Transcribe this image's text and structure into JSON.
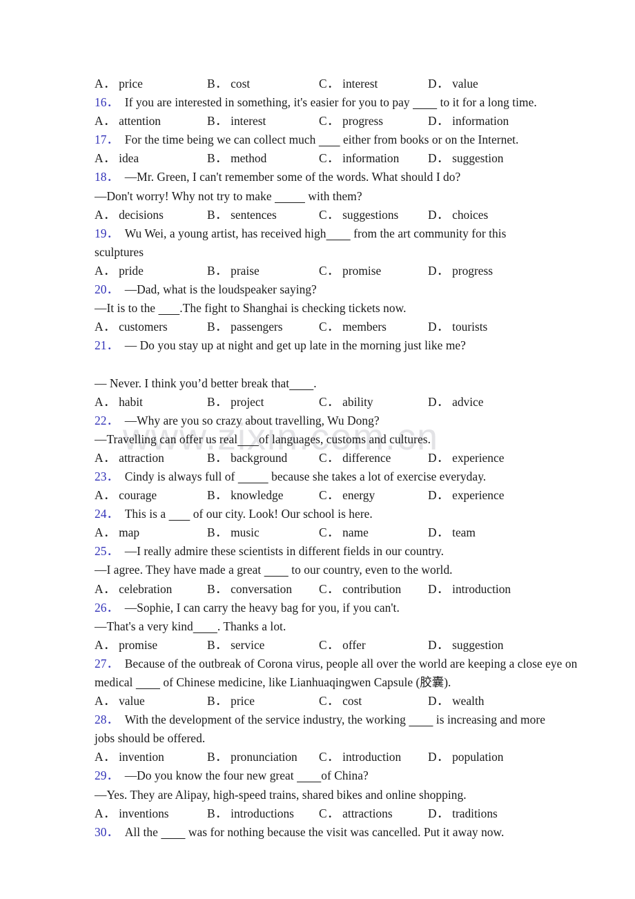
{
  "watermark": {
    "text": "www.zixin.com.cn"
  },
  "colors": {
    "question_number": "#3333b8",
    "body_text": "#1a1a1a",
    "watermark": "#e3e3e6"
  },
  "blank": "________",
  "blank_long": "__________",
  "blank_short": "_______",
  "blocks": [
    {
      "kind": "options",
      "options": [
        {
          "label": "A．",
          "text": "price"
        },
        {
          "label": "B．",
          "text": "cost"
        },
        {
          "label": "C．",
          "text": "interest"
        },
        {
          "label": "D．",
          "text": "value"
        }
      ]
    },
    {
      "kind": "question",
      "number": "16．",
      "lines": [
        {
          "pre": "If you are interested in something, it's easier for you to pay ",
          "blank": "________",
          "post": " to it for a long time."
        }
      ],
      "options": [
        {
          "label": "A．",
          "text": "attention"
        },
        {
          "label": "B．",
          "text": "interest"
        },
        {
          "label": "C．",
          "text": "progress"
        },
        {
          "label": "D．",
          "text": "information"
        }
      ]
    },
    {
      "kind": "question",
      "number": "17．",
      "lines": [
        {
          "pre": "For the time being we can collect much ",
          "blank": "_______",
          "post": " either from books or on the Internet."
        }
      ],
      "options": [
        {
          "label": "A．",
          "text": "idea"
        },
        {
          "label": "B．",
          "text": "method"
        },
        {
          "label": "C．",
          "text": "information"
        },
        {
          "label": "D．",
          "text": "suggestion"
        }
      ]
    },
    {
      "kind": "question",
      "number": "18．",
      "lines": [
        {
          "pre": "—Mr. Green, I can't remember some of the words. What should I do?",
          "blank": "",
          "post": ""
        },
        {
          "pre": "—Don't worry! Why not try to make ",
          "blank": "__________",
          "post": " with them?",
          "noindent": true
        }
      ],
      "options": [
        {
          "label": "A．",
          "text": "decisions"
        },
        {
          "label": "B．",
          "text": "sentences"
        },
        {
          "label": "C．",
          "text": "suggestions"
        },
        {
          "label": "D．",
          "text": "choices"
        }
      ]
    },
    {
      "kind": "question",
      "number": "19．",
      "lines": [
        {
          "pre": "Wu Wei, a young artist, has received high",
          "blank": "________",
          "post": " from the art community for this"
        },
        {
          "pre": "sculptures",
          "blank": "",
          "post": "",
          "noindent": true
        }
      ],
      "options": [
        {
          "label": "A．",
          "text": "pride"
        },
        {
          "label": "B．",
          "text": "praise"
        },
        {
          "label": "C．",
          "text": "promise"
        },
        {
          "label": "D．",
          "text": "progress"
        }
      ]
    },
    {
      "kind": "question",
      "number": "20．",
      "lines": [
        {
          "pre": "—Dad, what is the loudspeaker saying?",
          "blank": "",
          "post": ""
        },
        {
          "pre": "—It is to the ",
          "blank": "_______",
          "post": ".The fight to Shanghai is checking tickets now.",
          "noindent": true
        }
      ],
      "options": [
        {
          "label": "A．",
          "text": "customers"
        },
        {
          "label": "B．",
          "text": "passengers"
        },
        {
          "label": "C．",
          "text": "members"
        },
        {
          "label": "D．",
          "text": "tourists"
        }
      ]
    },
    {
      "kind": "question",
      "number": "21．",
      "lines": [
        {
          "pre": "— Do you stay up at night and get up late in the morning just like me?",
          "blank": "",
          "post": ""
        },
        {
          "pre": "",
          "blank": "",
          "post": "",
          "isblanksep": true
        },
        {
          "pre": "— Never. I think you’d better break that",
          "blank": "________",
          "post": ".",
          "noindent": true
        }
      ],
      "options": [
        {
          "label": "A．",
          "text": "habit"
        },
        {
          "label": "B．",
          "text": "project"
        },
        {
          "label": "C．",
          "text": "ability"
        },
        {
          "label": "D．",
          "text": "advice"
        }
      ]
    },
    {
      "kind": "question",
      "number": "22．",
      "lines": [
        {
          "pre": "—Why are you so crazy about travelling, Wu Dong?",
          "blank": "",
          "post": ""
        },
        {
          "pre": "—Travelling can offer us real",
          "blank": "_______",
          "post": "of languages, customs and cultures.",
          "noindent": true
        }
      ],
      "options": [
        {
          "label": "A．",
          "text": "attraction"
        },
        {
          "label": "B．",
          "text": "background"
        },
        {
          "label": "C．",
          "text": "difference"
        },
        {
          "label": "D．",
          "text": "experience"
        }
      ]
    },
    {
      "kind": "question",
      "number": "23．",
      "lines": [
        {
          "pre": "Cindy is always full of ",
          "blank": "__________",
          "post": " because she takes a lot of exercise everyday."
        }
      ],
      "options": [
        {
          "label": "A．",
          "text": "courage"
        },
        {
          "label": "B．",
          "text": "knowledge"
        },
        {
          "label": "C．",
          "text": "energy"
        },
        {
          "label": "D．",
          "text": "experience"
        }
      ]
    },
    {
      "kind": "question",
      "number": "24．",
      "lines": [
        {
          "pre": "This is a ",
          "blank": "_______",
          "post": " of our city. Look! Our school is here."
        }
      ],
      "options": [
        {
          "label": "A．",
          "text": "map"
        },
        {
          "label": "B．",
          "text": "music"
        },
        {
          "label": "C．",
          "text": "name"
        },
        {
          "label": "D．",
          "text": "team"
        }
      ]
    },
    {
      "kind": "question",
      "number": "25．",
      "lines": [
        {
          "pre": "—I really admire these scientists in different fields in our country.",
          "blank": "",
          "post": ""
        },
        {
          "pre": "—I agree. They have made a great ",
          "blank": "________",
          "post": " to our country, even to the world.",
          "noindent": true
        }
      ],
      "options": [
        {
          "label": "A．",
          "text": "celebration"
        },
        {
          "label": "B．",
          "text": "conversation"
        },
        {
          "label": "C．",
          "text": "contribution"
        },
        {
          "label": "D．",
          "text": "introduction"
        }
      ]
    },
    {
      "kind": "question",
      "number": "26．",
      "lines": [
        {
          "pre": "—Sophie, I can carry the heavy bag for you, if you can't.",
          "blank": "",
          "post": ""
        },
        {
          "pre": "—That's a very kind",
          "blank": "________",
          "post": ". Thanks a lot.",
          "noindent": true
        }
      ],
      "options": [
        {
          "label": "A．",
          "text": "promise"
        },
        {
          "label": "B．",
          "text": "service"
        },
        {
          "label": "C．",
          "text": "offer"
        },
        {
          "label": "D．",
          "text": "suggestion"
        }
      ]
    },
    {
      "kind": "question",
      "number": "27．",
      "lines": [
        {
          "pre": "Because of the outbreak of Corona virus, people all over the world are keeping a close eye on",
          "blank": "",
          "post": ""
        },
        {
          "pre": "medical ",
          "blank": "________",
          "post": " of Chinese medicine, like Lianhuaqingwen Capsule (胶囊).",
          "noindent": true
        }
      ],
      "options": [
        {
          "label": "A．",
          "text": "value"
        },
        {
          "label": "B．",
          "text": "price"
        },
        {
          "label": "C．",
          "text": "cost"
        },
        {
          "label": "D．",
          "text": "wealth"
        }
      ]
    },
    {
      "kind": "question",
      "number": "28．",
      "lines": [
        {
          "pre": "With the development of the service industry, the working ",
          "blank": "________",
          "post": " is increasing and more"
        },
        {
          "pre": "jobs should be offered.",
          "blank": "",
          "post": "",
          "noindent": true
        }
      ],
      "options": [
        {
          "label": "A．",
          "text": "invention"
        },
        {
          "label": "B．",
          "text": "pronunciation"
        },
        {
          "label": "C．",
          "text": "introduction"
        },
        {
          "label": "D．",
          "text": "population"
        }
      ]
    },
    {
      "kind": "question",
      "number": "29．",
      "lines": [
        {
          "pre": "—Do you know the four new great ",
          "blank": "________",
          "post": "of China?"
        },
        {
          "pre": "—Yes. They are Alipay, high-speed trains, shared bikes and online shopping.",
          "blank": "",
          "post": "",
          "noindent": true
        }
      ],
      "options": [
        {
          "label": "A．",
          "text": "inventions"
        },
        {
          "label": "B．",
          "text": "introductions"
        },
        {
          "label": "C．",
          "text": "attractions"
        },
        {
          "label": "D．",
          "text": "traditions"
        }
      ]
    },
    {
      "kind": "question",
      "number": "30．",
      "lines": [
        {
          "pre": "All the ",
          "blank": "________",
          "post": " was for nothing because the visit was cancelled. Put it away now."
        }
      ],
      "options": []
    }
  ]
}
